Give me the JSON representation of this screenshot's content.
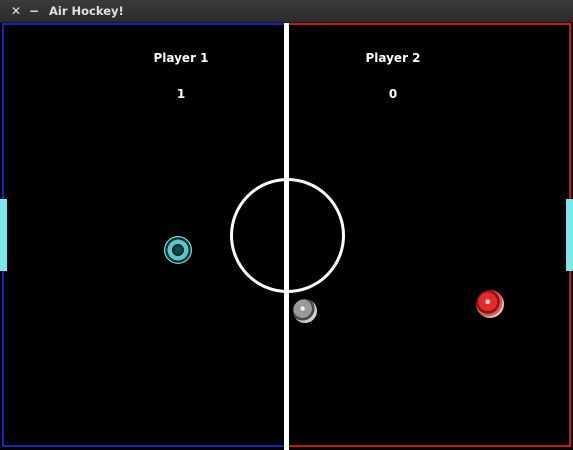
{
  "window": {
    "title": "Air Hockey!",
    "close_glyph": "✕",
    "minimize_glyph": "−"
  },
  "scoreboard": {
    "player1": {
      "name": "Player 1",
      "score": "1"
    },
    "player2": {
      "name": "Player 2",
      "score": "0"
    }
  },
  "colors": {
    "player1_side": "#1c22b8",
    "player2_side": "#c21a1a",
    "center_line": "#ffffff",
    "goal": "#7fe7ea",
    "player1_paddle": "#5fc3c8",
    "player2_paddle": "#e42b2b",
    "puck": "#9a9a9a"
  }
}
